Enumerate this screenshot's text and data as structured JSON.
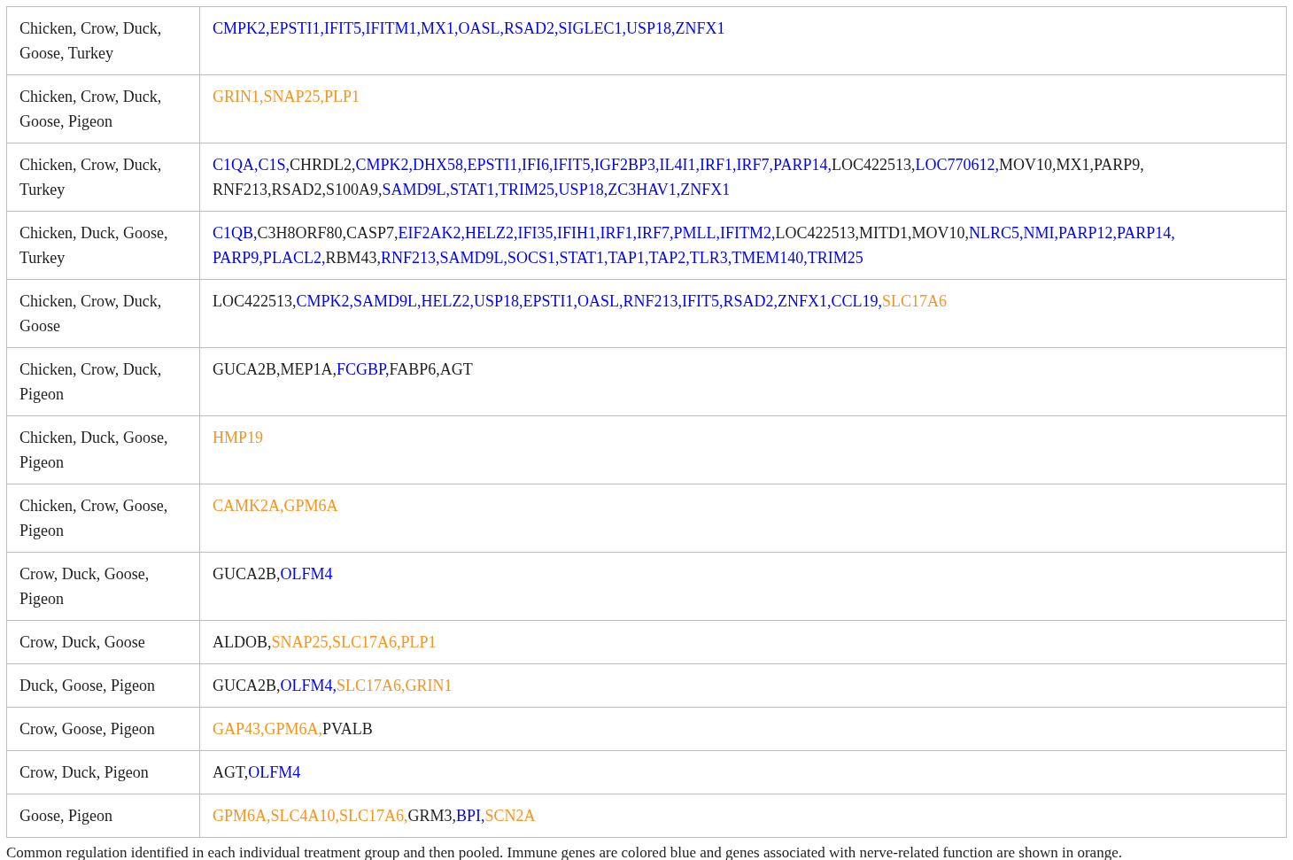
{
  "table": {
    "rows": [
      {
        "group": "Chicken, Crow, Duck, Goose, Turkey",
        "genes": [
          {
            "text": "CMPK2,EPSTI1,IFIT5,IFITM1,MX1,OASL,RSAD2,SIGLEC1,USP18,ZNFX1",
            "color": "#0000ff"
          }
        ]
      },
      {
        "group": "Chicken, Crow, Duck, Goose, Pigeon",
        "genes": [
          {
            "text": "GRIN1,SNAP25,PLP1",
            "color": "#f7931e"
          }
        ]
      },
      {
        "group": "Chicken, Crow, Duck, Turkey",
        "genes": [
          {
            "text": "C1QA,C1S,",
            "color": "#0000ff"
          },
          {
            "text": "CHRDL2,",
            "color": "#222222"
          },
          {
            "text": "CMPK2,DHX58,EPSTI1,IFI6,IFIT5,IGF2BP3,IL4I1,IRF1,IRF7,PARP14,",
            "color": "#0000ff"
          },
          {
            "text": "LOC422513,",
            "color": "#222222"
          },
          {
            "text": "LOC770612,",
            "color": "#0000ff"
          },
          {
            "text": "MOV10,MX1,PARP9,",
            "color": "#222222"
          },
          {
            "text": "RNF213,RSAD2,S100A9,",
            "color": "#222222"
          },
          {
            "text": "SAMD9L,STAT1,TRIM25,USP18,ZC3HAV1,ZNFX1",
            "color": "#0000ff"
          }
        ]
      },
      {
        "group": "Chicken, Duck, Goose, Turkey",
        "genes": [
          {
            "text": "C1QB,",
            "color": "#0000ff"
          },
          {
            "text": "C3H8ORF80,CASP7,",
            "color": "#222222"
          },
          {
            "text": "EIF2AK2,HELZ2,IFI35,IFIH1,IRF1,IRF7,PMLL,IFITM2,",
            "color": "#0000ff"
          },
          {
            "text": "LOC422513,MITD1,MOV10,",
            "color": "#222222"
          },
          {
            "text": "NLRC5,NMI,PARP12,PARP14,",
            "color": "#0000ff"
          },
          {
            "text": "PARP9,PLACL2,",
            "color": "#0000ff"
          },
          {
            "text": "RBM43,",
            "color": "#222222"
          },
          {
            "text": "RNF213,SAMD9L,SOCS1,STAT1,TAP1,TAP2,TLR3,TMEM140,TRIM25",
            "color": "#0000ff"
          }
        ]
      },
      {
        "group": "Chicken, Crow, Duck, Goose",
        "genes": [
          {
            "text": "LOC422513,",
            "color": "#222222"
          },
          {
            "text": "CMPK2,SAMD9L,HELZ2,USP18,EPSTI1,OASL,RNF213,IFIT5,RSAD2,ZNFX1,CCL19,",
            "color": "#0000ff"
          },
          {
            "text": "SLC17A6",
            "color": "#f7931e"
          }
        ]
      },
      {
        "group": "Chicken, Crow, Duck, Pigeon",
        "genes": [
          {
            "text": "GUCA2B,MEP1A,",
            "color": "#222222"
          },
          {
            "text": "FCGBP,",
            "color": "#0000ff"
          },
          {
            "text": "FABP6,AGT",
            "color": "#222222"
          }
        ]
      },
      {
        "group": "Chicken, Duck, Goose, Pigeon",
        "genes": [
          {
            "text": "HMP19",
            "color": "#f7931e"
          }
        ]
      },
      {
        "group": "Chicken, Crow, Goose, Pigeon",
        "genes": [
          {
            "text": "CAMK2A,GPM6A",
            "color": "#f7931e"
          }
        ]
      },
      {
        "group": "Crow, Duck, Goose, Pigeon",
        "genes": [
          {
            "text": "GUCA2B,",
            "color": "#222222"
          },
          {
            "text": "OLFM4",
            "color": "#0000ff"
          }
        ]
      },
      {
        "group": "Crow, Duck, Goose",
        "genes": [
          {
            "text": "ALDOB,",
            "color": "#222222"
          },
          {
            "text": "SNAP25,SLC17A6,PLP1",
            "color": "#f7931e"
          }
        ]
      },
      {
        "group": "Duck, Goose, Pigeon",
        "genes": [
          {
            "text": "GUCA2B,",
            "color": "#222222"
          },
          {
            "text": "OLFM4,",
            "color": "#0000ff"
          },
          {
            "text": "SLC17A6,GRIN1",
            "color": "#f7931e"
          }
        ]
      },
      {
        "group": "Crow, Goose, Pigeon",
        "genes": [
          {
            "text": "GAP43,GPM6A,",
            "color": "#f7931e"
          },
          {
            "text": "PVALB",
            "color": "#222222"
          }
        ]
      },
      {
        "group": "Crow, Duck, Pigeon",
        "genes": [
          {
            "text": "AGT,",
            "color": "#222222"
          },
          {
            "text": "OLFM4",
            "color": "#0000ff"
          }
        ]
      },
      {
        "group": "Goose, Pigeon",
        "genes": [
          {
            "text": "GPM6A,SLC4A10,SLC17A6,",
            "color": "#f7931e"
          },
          {
            "text": "GRM3,",
            "color": "#222222"
          },
          {
            "text": "BPI,",
            "color": "#0000ff"
          },
          {
            "text": "SCN2A",
            "color": "#f7931e"
          }
        ]
      }
    ]
  },
  "caption": "Common regulation identified in each individual treatment group and then pooled. Immune genes are colored blue and genes associated with nerve-related function are shown in orange."
}
